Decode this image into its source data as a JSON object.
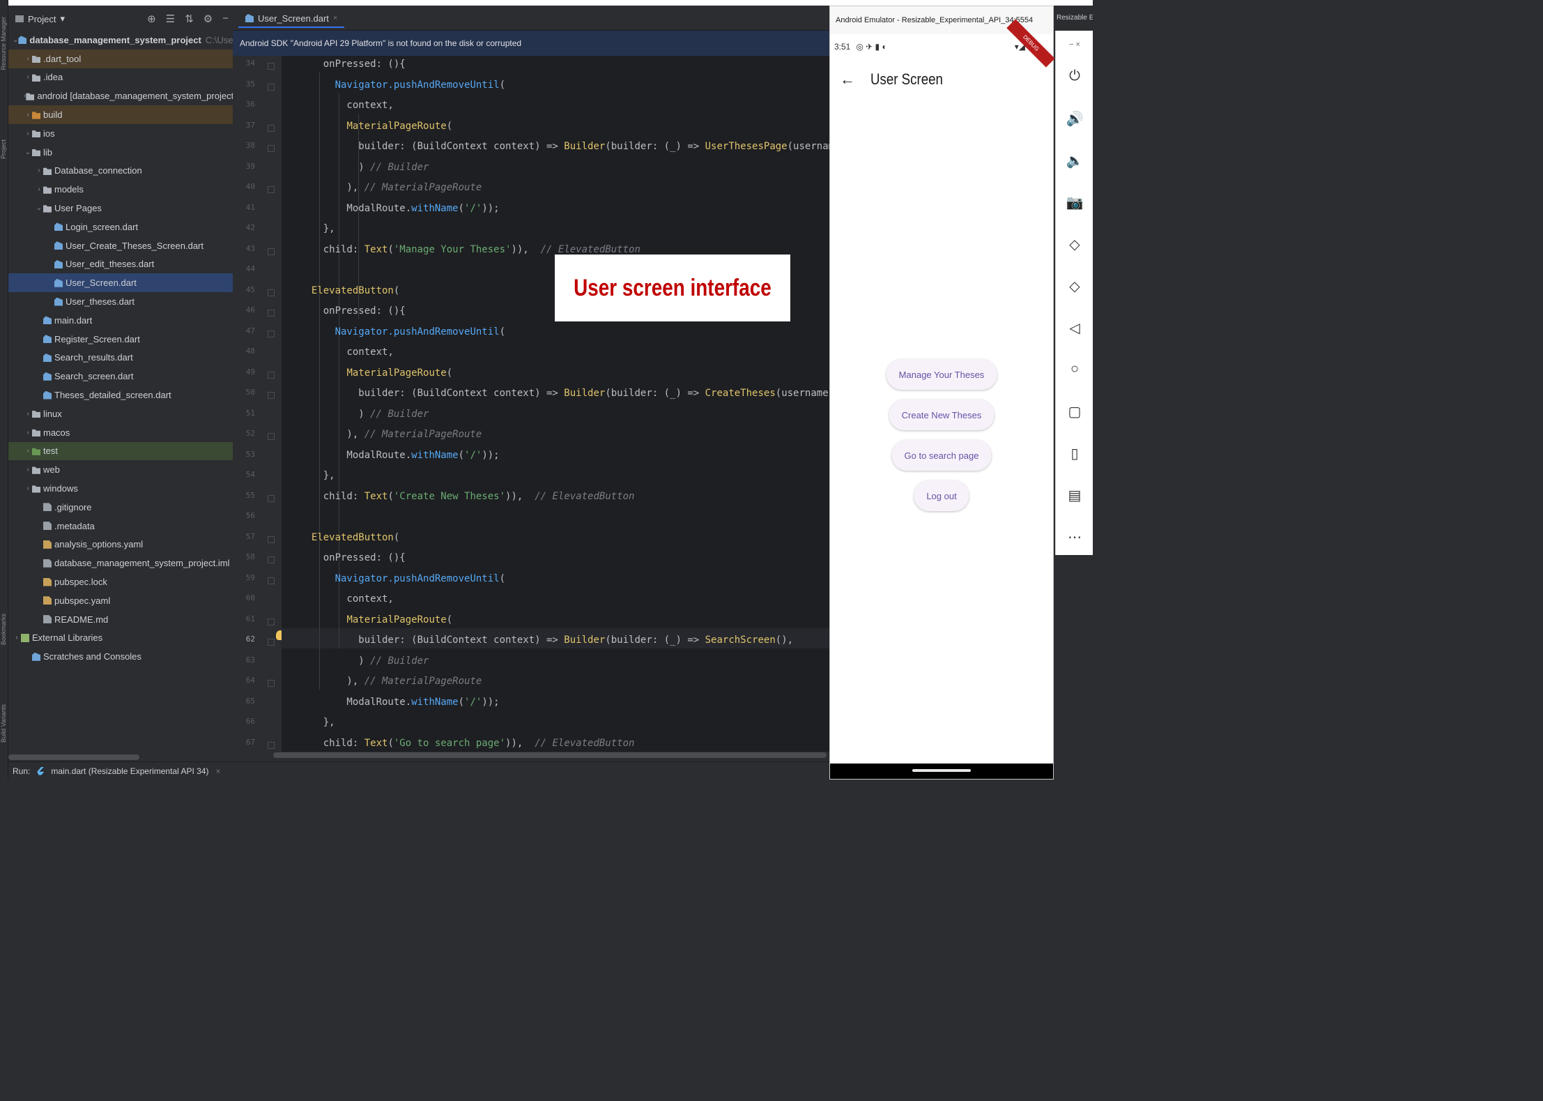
{
  "ide": {
    "project_label": "Project",
    "project_dropdown": "▾",
    "toolbar_icons": [
      "⊕",
      "☰",
      "⇅",
      "⚙",
      "−"
    ],
    "side_tool_labels": {
      "resource_manager": "Resource Manager",
      "project": "Project",
      "bookmarks": "Bookmarks",
      "build_variants": "Build Variants"
    },
    "tree": [
      {
        "indent": 0,
        "arrow": "⌄",
        "icon": "flutter-icon",
        "label": "database_management_system_project",
        "suffix": "C:\\Users\\Mehmed",
        "style": "root"
      },
      {
        "indent": 1,
        "arrow": "›",
        "icon": "folder",
        "label": ".dart_tool",
        "style": "orange"
      },
      {
        "indent": 1,
        "arrow": "›",
        "icon": "folder",
        "label": ".idea",
        "style": ""
      },
      {
        "indent": 1,
        "arrow": "›",
        "icon": "folder",
        "label": "android [database_management_system_project_android]",
        "style": ""
      },
      {
        "indent": 1,
        "arrow": "›",
        "icon": "folder-orange",
        "label": "build",
        "style": "orange"
      },
      {
        "indent": 1,
        "arrow": "›",
        "icon": "folder",
        "label": "ios",
        "style": ""
      },
      {
        "indent": 1,
        "arrow": "⌄",
        "icon": "folder",
        "label": "lib",
        "style": ""
      },
      {
        "indent": 2,
        "arrow": "›",
        "icon": "folder",
        "label": "Database_connection",
        "style": ""
      },
      {
        "indent": 2,
        "arrow": "›",
        "icon": "folder",
        "label": "models",
        "style": ""
      },
      {
        "indent": 2,
        "arrow": "⌄",
        "icon": "folder",
        "label": "User Pages",
        "style": ""
      },
      {
        "indent": 3,
        "arrow": "",
        "icon": "dart",
        "label": "Login_screen.dart",
        "style": ""
      },
      {
        "indent": 3,
        "arrow": "",
        "icon": "dart",
        "label": "User_Create_Theses_Screen.dart",
        "style": ""
      },
      {
        "indent": 3,
        "arrow": "",
        "icon": "dart",
        "label": "User_edit_theses.dart",
        "style": ""
      },
      {
        "indent": 3,
        "arrow": "",
        "icon": "dart",
        "label": "User_Screen.dart",
        "style": "selected"
      },
      {
        "indent": 3,
        "arrow": "",
        "icon": "dart",
        "label": "User_theses.dart",
        "style": ""
      },
      {
        "indent": 2,
        "arrow": "",
        "icon": "dart",
        "label": "main.dart",
        "style": ""
      },
      {
        "indent": 2,
        "arrow": "",
        "icon": "dart",
        "label": "Register_Screen.dart",
        "style": ""
      },
      {
        "indent": 2,
        "arrow": "",
        "icon": "dart",
        "label": "Search_results.dart",
        "style": ""
      },
      {
        "indent": 2,
        "arrow": "",
        "icon": "dart",
        "label": "Search_screen.dart",
        "style": ""
      },
      {
        "indent": 2,
        "arrow": "",
        "icon": "dart",
        "label": "Theses_detailed_screen.dart",
        "style": ""
      },
      {
        "indent": 1,
        "arrow": "›",
        "icon": "folder",
        "label": "linux",
        "style": ""
      },
      {
        "indent": 1,
        "arrow": "›",
        "icon": "folder",
        "label": "macos",
        "style": ""
      },
      {
        "indent": 1,
        "arrow": "›",
        "icon": "folder-green",
        "label": "test",
        "style": "green"
      },
      {
        "indent": 1,
        "arrow": "›",
        "icon": "folder",
        "label": "web",
        "style": ""
      },
      {
        "indent": 1,
        "arrow": "›",
        "icon": "folder",
        "label": "windows",
        "style": ""
      },
      {
        "indent": 2,
        "arrow": "",
        "icon": "file",
        "label": ".gitignore",
        "style": ""
      },
      {
        "indent": 2,
        "arrow": "",
        "icon": "file",
        "label": ".metadata",
        "style": ""
      },
      {
        "indent": 2,
        "arrow": "",
        "icon": "yaml",
        "label": "analysis_options.yaml",
        "style": ""
      },
      {
        "indent": 2,
        "arrow": "",
        "icon": "file",
        "label": "database_management_system_project.iml",
        "style": ""
      },
      {
        "indent": 2,
        "arrow": "",
        "icon": "yaml",
        "label": "pubspec.lock",
        "style": ""
      },
      {
        "indent": 2,
        "arrow": "",
        "icon": "yaml",
        "label": "pubspec.yaml",
        "style": ""
      },
      {
        "indent": 2,
        "arrow": "",
        "icon": "file",
        "label": "README.md",
        "style": ""
      },
      {
        "indent": 0,
        "arrow": "›",
        "icon": "lib",
        "label": "External Libraries",
        "style": ""
      },
      {
        "indent": 1,
        "arrow": "",
        "icon": "scratch",
        "label": "Scratches and Consoles",
        "style": ""
      }
    ],
    "editor_tab": "User_Screen.dart",
    "editor_tab_close": "×",
    "notice": "Android SDK \"Android API 29 Platform\" is not found on the disk or corrupted",
    "line_numbers": [
      "34",
      "35",
      "36",
      "37",
      "38",
      "39",
      "40",
      "41",
      "42",
      "43",
      "44",
      "45",
      "46",
      "47",
      "48",
      "49",
      "50",
      "51",
      "52",
      "53",
      "54",
      "55",
      "56",
      "57",
      "58",
      "59",
      "60",
      "61",
      "62",
      "63",
      "64",
      "65",
      "66",
      "67"
    ],
    "active_line": "62",
    "run_label": "Run:",
    "run_config": "main.dart (Resizable Experimental API 34)",
    "run_close": "×"
  },
  "code_lines": [
    [
      [
        "",
        "    onPressed: (){"
      ]
    ],
    [
      [
        "",
        "      "
      ],
      [
        "f",
        "Navigator.pushAndRemoveUntil"
      ],
      [
        "",
        "("
      ]
    ],
    [
      [
        "",
        "        context,"
      ]
    ],
    [
      [
        "",
        "        "
      ],
      [
        "cls",
        "MaterialPageRoute"
      ],
      [
        "",
        "("
      ]
    ],
    [
      [
        "",
        "          builder: (BuildContext context) => "
      ],
      [
        "cls",
        "Builder"
      ],
      [
        "",
        "(builder: (_) => "
      ],
      [
        "cls",
        "UserThesesPage"
      ],
      [
        "",
        "(username: wid"
      ]
    ],
    [
      [
        "",
        "          ) "
      ],
      [
        "c",
        "// Builder"
      ]
    ],
    [
      [
        "",
        "        ), "
      ],
      [
        "c",
        "// MaterialPageRoute"
      ]
    ],
    [
      [
        "",
        "        ModalRoute."
      ],
      [
        "f",
        "withName"
      ],
      [
        "",
        "("
      ],
      [
        "s",
        "'/'"
      ],
      [
        "",
        "));"
      ]
    ],
    [
      [
        "",
        "    },"
      ]
    ],
    [
      [
        "",
        "    child: "
      ],
      [
        "cls",
        "Text"
      ],
      [
        "",
        "("
      ],
      [
        "s",
        "'Manage Your Theses'"
      ],
      [
        "",
        ")),  "
      ],
      [
        "c",
        "// ElevatedButton"
      ]
    ],
    [
      [
        "",
        ""
      ]
    ],
    [
      [
        "cls",
        "  ElevatedButton"
      ],
      [
        "",
        "("
      ]
    ],
    [
      [
        "",
        "    onPressed: (){"
      ]
    ],
    [
      [
        "",
        "      "
      ],
      [
        "f",
        "Navigator.pushAndRemoveUntil"
      ],
      [
        "",
        "("
      ]
    ],
    [
      [
        "",
        "        context,"
      ]
    ],
    [
      [
        "",
        "        "
      ],
      [
        "cls",
        "MaterialPageRoute"
      ],
      [
        "",
        "("
      ]
    ],
    [
      [
        "",
        "          builder: (BuildContext context) => "
      ],
      [
        "cls",
        "Builder"
      ],
      [
        "",
        "(builder: (_) => "
      ],
      [
        "cls",
        "CreateTheses"
      ],
      [
        "",
        "(username: widge"
      ]
    ],
    [
      [
        "",
        "          ) "
      ],
      [
        "c",
        "// Builder"
      ]
    ],
    [
      [
        "",
        "        ), "
      ],
      [
        "c",
        "// MaterialPageRoute"
      ]
    ],
    [
      [
        "",
        "        ModalRoute."
      ],
      [
        "f",
        "withName"
      ],
      [
        "",
        "("
      ],
      [
        "s",
        "'/'"
      ],
      [
        "",
        "));"
      ]
    ],
    [
      [
        "",
        "    },"
      ]
    ],
    [
      [
        "",
        "    child: "
      ],
      [
        "cls",
        "Text"
      ],
      [
        "",
        "("
      ],
      [
        "s",
        "'Create New Theses'"
      ],
      [
        "",
        ")),  "
      ],
      [
        "c",
        "// ElevatedButton"
      ]
    ],
    [
      [
        "",
        ""
      ]
    ],
    [
      [
        "cls",
        "  ElevatedButton"
      ],
      [
        "",
        "("
      ]
    ],
    [
      [
        "",
        "    onPressed: (){"
      ]
    ],
    [
      [
        "",
        "      "
      ],
      [
        "f",
        "Navigator.pushAndRemoveUntil"
      ],
      [
        "",
        "("
      ]
    ],
    [
      [
        "",
        "        context,"
      ]
    ],
    [
      [
        "",
        "        "
      ],
      [
        "cls",
        "MaterialPageRoute"
      ],
      [
        "",
        "("
      ]
    ],
    [
      [
        "",
        "          builder: (BuildContext context) => "
      ],
      [
        "cls",
        "Builder"
      ],
      [
        "",
        "(builder: (_) => "
      ],
      [
        "cls",
        "SearchScreen"
      ],
      [
        "",
        "(),"
      ]
    ],
    [
      [
        "",
        "          ) "
      ],
      [
        "c",
        "// Builder"
      ]
    ],
    [
      [
        "",
        "        ), "
      ],
      [
        "c",
        "// MaterialPageRoute"
      ]
    ],
    [
      [
        "",
        "        ModalRoute."
      ],
      [
        "f",
        "withName"
      ],
      [
        "",
        "("
      ],
      [
        "s",
        "'/'"
      ],
      [
        "",
        "));"
      ]
    ],
    [
      [
        "",
        "    },"
      ]
    ],
    [
      [
        "",
        "    child: "
      ],
      [
        "cls",
        "Text"
      ],
      [
        "",
        "("
      ],
      [
        "s",
        "'Go to search page'"
      ],
      [
        "",
        ")),  "
      ],
      [
        "c",
        "// ElevatedButton"
      ]
    ]
  ],
  "annotation": "User screen interface",
  "emulator": {
    "window_title": "Android Emulator - Resizable_Experimental_API_34:5554",
    "status_time": "3:51",
    "status_icons": "◎ ✈ ▮ ◐",
    "signal_icons": "▾◢",
    "debug_banner": "DEBUG",
    "app_title": "User Screen",
    "back_arrow": "←",
    "buttons": [
      "Manage Your Theses",
      "Create New Theses",
      "Go to search page",
      "Log out"
    ],
    "side_header": "Resizable Ex",
    "side_controls": [
      "⏻",
      "🔊",
      "🔈",
      "📷",
      "◇",
      "◇",
      "◁",
      "○",
      "▢",
      "▯",
      "▤",
      "⋯"
    ],
    "window_controls": "−  ×"
  }
}
